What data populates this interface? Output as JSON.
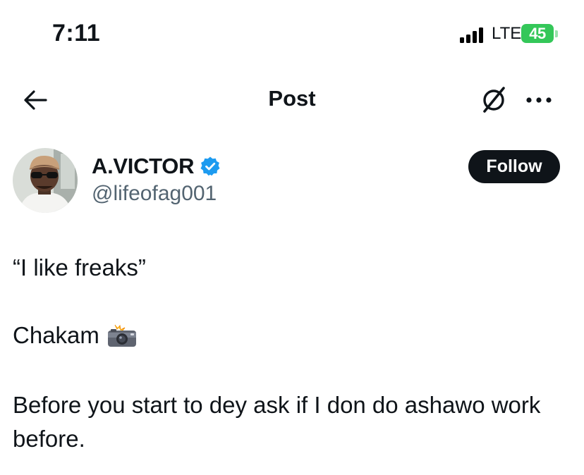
{
  "status_bar": {
    "time": "7:11",
    "network": "LTE",
    "battery": "45"
  },
  "header": {
    "title": "Post",
    "icons": [
      "back-arrow-icon",
      "grok-icon",
      "more-icon"
    ]
  },
  "author": {
    "name": "A.VICTOR",
    "handle": "@lifeofag001",
    "verified": true,
    "follow_label": "Follow"
  },
  "post": {
    "line1": "“I like freaks”",
    "line2": "Chakam",
    "line2_emoji": "camera-flash-icon",
    "line3": "Before you start to dey ask if I don do ashawo work before."
  },
  "colors": {
    "text": "#0f1419",
    "secondary": "#536471",
    "verified": "#1d9bf0",
    "battery": "#34c759",
    "follow_bg": "#0f1419"
  }
}
